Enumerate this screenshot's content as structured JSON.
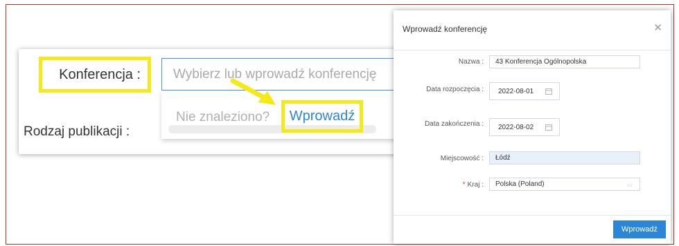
{
  "background_form": {
    "conference_label": "Konferencja :",
    "conference_input_placeholder": "Wybierz lub wprowadź konferencję",
    "publication_type_label": "Rodzaj publikacji :",
    "suggestion_not_found": "Nie znaleziono?",
    "suggestion_link": "Wprowadź"
  },
  "dialog": {
    "title": "Wprowadź konferencję",
    "close_icon": "close-icon",
    "fields": {
      "name": {
        "label": "Nazwa :",
        "value": "43 Konferencja Ogólnopolska"
      },
      "start_date": {
        "label": "Data rozpoczęcia :",
        "value": "2022-08-01",
        "icon": "calendar-icon"
      },
      "end_date": {
        "label": "Data zakończenia :",
        "value": "2022-08-02",
        "icon": "calendar-icon"
      },
      "city": {
        "label": "Miejscowość :",
        "value": "Łódź"
      },
      "country": {
        "label": "Kraj :",
        "required_marker": "*",
        "value": "Polska (Poland)",
        "icon": "chevron-down-icon"
      }
    },
    "submit_label": "Wprowadź"
  },
  "colors": {
    "highlight_yellow": "#f4ea1a",
    "link_blue": "#2c86d8",
    "frame_border": "#a23a28",
    "required_red": "#e43b3b"
  }
}
